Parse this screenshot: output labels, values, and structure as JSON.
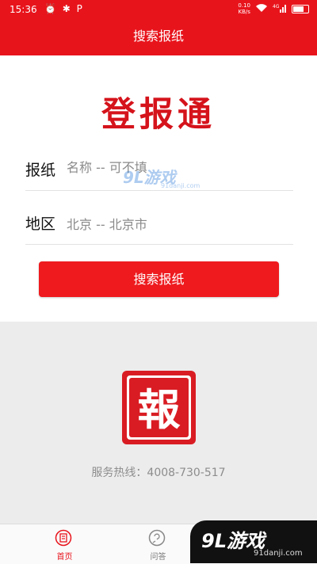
{
  "status_bar": {
    "time": "15:36",
    "left_icons": "⏰ ✱ P",
    "net_speed_value": "0.10",
    "net_speed_unit": "KB/s",
    "signal_label": "4G"
  },
  "header": {
    "title": "搜索报纸"
  },
  "main": {
    "logo_title": "登报通",
    "newspaper_field": {
      "label": "报纸",
      "placeholder": "名称 -- 可不填"
    },
    "region_field": {
      "label": "地区",
      "value": "北京 -- 北京市"
    },
    "search_button_label": "搜索报纸"
  },
  "footer_info": {
    "seal_char": "報",
    "service_line": "服务热线：4008-730-517"
  },
  "tab_bar": {
    "tabs": [
      {
        "label": "首页",
        "icon": "home-icon",
        "active": true
      },
      {
        "label": "问答",
        "icon": "qa-icon",
        "active": false
      }
    ]
  },
  "watermarks": {
    "logo": "9L游戏",
    "url": "91danji.com"
  },
  "colors": {
    "brand_red": "#e8141c",
    "title_red": "#d5131b",
    "button_red": "#ee1a1e",
    "seal_red": "#d91c23"
  }
}
